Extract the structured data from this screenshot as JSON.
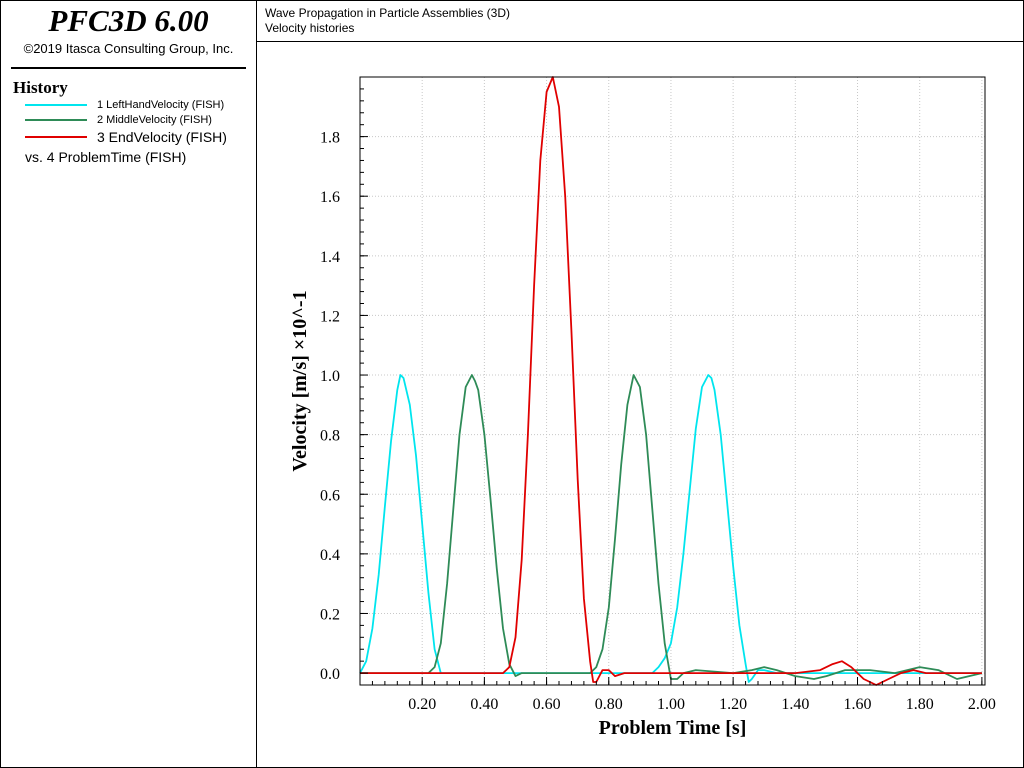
{
  "sidebar": {
    "app_title": "PFC3D 6.00",
    "copyright": "©2019 Itasca Consulting Group, Inc.",
    "history_heading": "History",
    "legend": [
      {
        "label": "1 LeftHandVelocity (FISH)",
        "color": "#00e5ee"
      },
      {
        "label": "2 MiddleVelocity (FISH)",
        "color": "#2e8b57"
      },
      {
        "label": "3 EndVelocity (FISH)",
        "color": "#e00000"
      }
    ],
    "vs_label": "vs. 4 ProblemTime (FISH)"
  },
  "header": {
    "title": "Wave Propagation in Particle Assemblies (3D)",
    "subtitle": "Velocity histories"
  },
  "chart_data": {
    "type": "line",
    "xlabel": "Problem Time [s]",
    "ylabel": "Velocity [m/s] ×10^-1",
    "xlim": [
      0.0,
      2.01
    ],
    "ylim": [
      -0.04,
      2.0
    ],
    "xticks": [
      0.2,
      0.4,
      0.6,
      0.8,
      1.0,
      1.2,
      1.4,
      1.6,
      1.8,
      2.0
    ],
    "xtick_labels": [
      "0.20",
      "0.40",
      "0.60",
      "0.80",
      "1.00",
      "1.20",
      "1.40",
      "1.60",
      "1.80",
      "2.00"
    ],
    "yticks": [
      0.0,
      0.2,
      0.4,
      0.6,
      0.8,
      1.0,
      1.2,
      1.4,
      1.6,
      1.8
    ],
    "ytick_labels": [
      "0.0",
      "0.2",
      "0.4",
      "0.6",
      "0.8",
      "1.0",
      "1.2",
      "1.4",
      "1.6",
      "1.8"
    ],
    "grid": true,
    "series": [
      {
        "name": "1 LeftHandVelocity (FISH)",
        "color": "#00e5ee",
        "x": [
          0.0,
          0.02,
          0.04,
          0.06,
          0.08,
          0.1,
          0.12,
          0.13,
          0.14,
          0.16,
          0.18,
          0.2,
          0.22,
          0.24,
          0.26,
          0.3,
          0.5,
          0.8,
          0.9,
          0.94,
          0.96,
          0.98,
          1.0,
          1.02,
          1.04,
          1.06,
          1.08,
          1.1,
          1.12,
          1.13,
          1.14,
          1.16,
          1.18,
          1.2,
          1.22,
          1.24,
          1.25,
          1.26,
          1.28,
          1.3,
          1.34,
          1.4,
          1.5,
          1.6,
          1.7,
          1.8,
          1.9,
          2.0
        ],
        "y": [
          0.0,
          0.04,
          0.15,
          0.33,
          0.56,
          0.78,
          0.95,
          1.0,
          0.99,
          0.9,
          0.73,
          0.5,
          0.27,
          0.08,
          0.0,
          0.0,
          0.0,
          0.0,
          0.0,
          0.0,
          0.02,
          0.05,
          0.1,
          0.22,
          0.4,
          0.61,
          0.82,
          0.96,
          1.0,
          0.99,
          0.95,
          0.8,
          0.58,
          0.36,
          0.16,
          0.03,
          -0.03,
          -0.02,
          0.01,
          0.01,
          0.0,
          0.0,
          0.0,
          0.0,
          0.0,
          0.0,
          0.0,
          0.0
        ]
      },
      {
        "name": "2 MiddleVelocity (FISH)",
        "color": "#2e8b57",
        "x": [
          0.0,
          0.22,
          0.24,
          0.26,
          0.28,
          0.3,
          0.32,
          0.34,
          0.36,
          0.37,
          0.38,
          0.4,
          0.42,
          0.44,
          0.46,
          0.48,
          0.5,
          0.52,
          0.6,
          0.7,
          0.74,
          0.76,
          0.78,
          0.8,
          0.82,
          0.84,
          0.86,
          0.88,
          0.9,
          0.92,
          0.94,
          0.96,
          0.98,
          1.0,
          1.02,
          1.04,
          1.08,
          1.2,
          1.26,
          1.3,
          1.34,
          1.4,
          1.46,
          1.5,
          1.56,
          1.64,
          1.72,
          1.8,
          1.86,
          1.92,
          2.0
        ],
        "y": [
          0.0,
          0.0,
          0.02,
          0.1,
          0.3,
          0.55,
          0.8,
          0.96,
          1.0,
          0.98,
          0.95,
          0.8,
          0.58,
          0.35,
          0.15,
          0.03,
          -0.01,
          0.0,
          0.0,
          0.0,
          0.0,
          0.02,
          0.08,
          0.22,
          0.45,
          0.7,
          0.9,
          1.0,
          0.96,
          0.8,
          0.55,
          0.3,
          0.1,
          -0.02,
          -0.02,
          0.0,
          0.01,
          0.0,
          0.01,
          0.02,
          0.01,
          -0.01,
          -0.02,
          -0.01,
          0.01,
          0.01,
          0.0,
          0.02,
          0.01,
          -0.02,
          0.0
        ]
      },
      {
        "name": "3 EndVelocity (FISH)",
        "color": "#e00000",
        "x": [
          0.0,
          0.46,
          0.48,
          0.5,
          0.52,
          0.54,
          0.56,
          0.58,
          0.6,
          0.62,
          0.64,
          0.66,
          0.68,
          0.7,
          0.72,
          0.74,
          0.75,
          0.76,
          0.78,
          0.8,
          0.82,
          0.85,
          0.9,
          1.0,
          1.2,
          1.4,
          1.48,
          1.52,
          1.55,
          1.58,
          1.62,
          1.66,
          1.7,
          1.74,
          1.78,
          1.82,
          1.9,
          2.0
        ],
        "y": [
          0.0,
          0.0,
          0.02,
          0.12,
          0.38,
          0.8,
          1.3,
          1.72,
          1.95,
          2.0,
          1.9,
          1.6,
          1.15,
          0.65,
          0.25,
          0.04,
          -0.03,
          -0.03,
          0.01,
          0.01,
          -0.01,
          0.0,
          0.0,
          0.0,
          0.0,
          0.0,
          0.01,
          0.03,
          0.04,
          0.02,
          -0.02,
          -0.04,
          -0.02,
          0.0,
          0.01,
          0.0,
          0.0,
          0.0
        ]
      }
    ]
  }
}
